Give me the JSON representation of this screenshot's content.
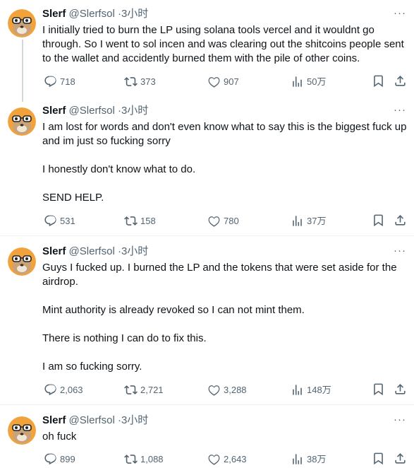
{
  "tweets": [
    {
      "name": "Slerf",
      "handle": "@Slerfsol",
      "time": "3小时",
      "text": [
        "I initially tried to burn the LP using solana tools vercel and it wouldnt go through. So I went to sol incen and was clearing out the shitcoins people sent to the wallet and accidently burned them with the pile of other coins."
      ],
      "replies": "718",
      "reposts": "373",
      "likes": "907",
      "views": "50万"
    },
    {
      "name": "Slerf",
      "handle": "@Slerfsol",
      "time": "3小时",
      "text": [
        "I am lost for words and don't even know what to say this is the biggest fuck up and im just so fucking sorry",
        "I honestly don't know what to do.",
        "SEND HELP."
      ],
      "replies": "531",
      "reposts": "158",
      "likes": "780",
      "views": "37万"
    },
    {
      "name": "Slerf",
      "handle": "@Slerfsol",
      "time": "3小时",
      "text": [
        "Guys I fucked up. I burned the LP and the tokens that were set aside for the airdrop.",
        "Mint authority is already revoked so I can not mint them.",
        "There is nothing I can do to fix this.",
        "I am so fucking sorry."
      ],
      "replies": "2,063",
      "reposts": "2,721",
      "likes": "3,288",
      "views": "148万"
    },
    {
      "name": "Slerf",
      "handle": "@Slerfsol",
      "time": "3小时",
      "text": [
        "oh fuck"
      ],
      "replies": "899",
      "reposts": "1,088",
      "likes": "2,643",
      "views": "38万"
    }
  ],
  "meta_separator": "·",
  "more_glyph": "···",
  "icons": {
    "reply": "reply-icon",
    "repost": "repost-icon",
    "like": "like-icon",
    "views": "views-icon",
    "bookmark": "bookmark-icon",
    "share": "share-icon",
    "more": "more-icon"
  },
  "colors": {
    "text": "#0f1419",
    "secondary": "#536471",
    "divider": "#eff3f4",
    "avatar_bg": "#f2a23a"
  }
}
